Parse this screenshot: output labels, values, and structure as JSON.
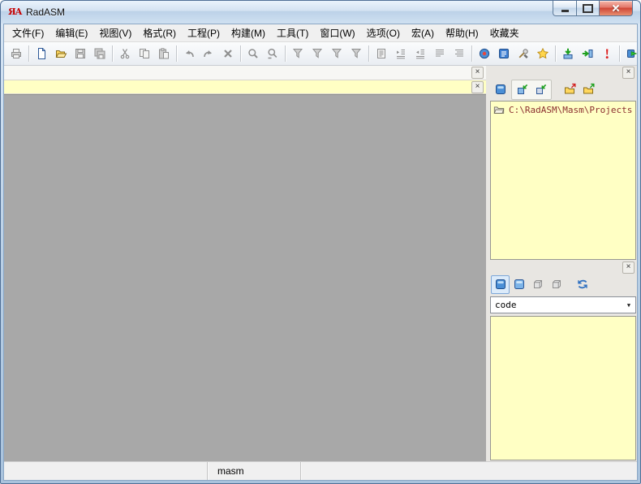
{
  "window": {
    "title": "RadASM",
    "logo_glyph": "ЯA"
  },
  "icons": {
    "close_glyph": "×",
    "combo_arrow_glyph": "▼"
  },
  "colors": {
    "panel_yellow": "#ffffc4",
    "mdi_gray": "#a8a8a8",
    "titlebar_blue": "#cfe0f1",
    "close_button_red": "#cf4636",
    "tree_text": "#8b2f2f"
  },
  "menu": {
    "items": [
      {
        "id": "file",
        "label": "文件(F)"
      },
      {
        "id": "edit",
        "label": "编辑(E)"
      },
      {
        "id": "view",
        "label": "视图(V)"
      },
      {
        "id": "format",
        "label": "格式(R)"
      },
      {
        "id": "project",
        "label": "工程(P)"
      },
      {
        "id": "make",
        "label": "构建(M)"
      },
      {
        "id": "tools",
        "label": "工具(T)"
      },
      {
        "id": "window",
        "label": "窗口(W)"
      },
      {
        "id": "options",
        "label": "选项(O)"
      },
      {
        "id": "macro",
        "label": "宏(A)"
      },
      {
        "id": "help",
        "label": "帮助(H)"
      },
      {
        "id": "favorites",
        "label": "收藏夹"
      }
    ]
  },
  "toolbar": {
    "buttons": [
      {
        "icon": "print",
        "enabled": false
      },
      {
        "sep": true
      },
      {
        "icon": "new-file",
        "enabled": true
      },
      {
        "icon": "open-file",
        "enabled": true
      },
      {
        "icon": "save",
        "enabled": false
      },
      {
        "icon": "save-all",
        "enabled": false
      },
      {
        "sep": true
      },
      {
        "icon": "cut",
        "enabled": false
      },
      {
        "icon": "copy",
        "enabled": false
      },
      {
        "icon": "paste",
        "enabled": false
      },
      {
        "sep": true
      },
      {
        "icon": "undo",
        "enabled": false
      },
      {
        "icon": "redo",
        "enabled": false
      },
      {
        "icon": "delete",
        "enabled": false
      },
      {
        "sep": true
      },
      {
        "icon": "find",
        "enabled": false
      },
      {
        "icon": "find-next",
        "enabled": false
      },
      {
        "sep": true
      },
      {
        "icon": "toggle-bookmark",
        "enabled": false
      },
      {
        "icon": "next-bookmark",
        "enabled": false
      },
      {
        "icon": "prev-bookmark",
        "enabled": false
      },
      {
        "icon": "clear-bookmarks",
        "enabled": false
      },
      {
        "sep": true
      },
      {
        "icon": "copy-section",
        "enabled": false
      },
      {
        "icon": "indent",
        "enabled": false
      },
      {
        "icon": "outdent",
        "enabled": false
      },
      {
        "icon": "align-lines",
        "enabled": false
      },
      {
        "icon": "align-fields",
        "enabled": false
      },
      {
        "sep": true
      },
      {
        "icon": "project-browser",
        "enabled": true
      },
      {
        "icon": "templates",
        "enabled": true
      },
      {
        "icon": "project-options",
        "enabled": true
      },
      {
        "icon": "addins",
        "enabled": true
      },
      {
        "sep": true
      },
      {
        "icon": "assemble",
        "enabled": true
      },
      {
        "icon": "link",
        "enabled": true
      },
      {
        "icon": "build-errors",
        "enabled": true
      },
      {
        "sep": true
      },
      {
        "icon": "run",
        "enabled": true
      }
    ]
  },
  "project_panel": {
    "root_path": "C:\\RadASM\\Masm\\Projects",
    "toolbar": [
      {
        "icon": "project-view",
        "enabled": true
      },
      {
        "icon": "add-module",
        "enabled": true,
        "box": true
      },
      {
        "icon": "add-project",
        "enabled": true,
        "box": true
      },
      {
        "icon": "open-folder-red",
        "enabled": true,
        "gap": true
      },
      {
        "icon": "open-folder-green",
        "enabled": true
      }
    ]
  },
  "properties_panel": {
    "combo_value": "code",
    "toolbar": [
      {
        "icon": "dialog-editor",
        "enabled": true,
        "selected": true
      },
      {
        "icon": "code-editor",
        "enabled": true
      },
      {
        "icon": "resource-cube-1",
        "enabled": false
      },
      {
        "icon": "resource-cube-2",
        "enabled": false
      },
      {
        "icon": "refresh",
        "enabled": true,
        "gap": true
      }
    ]
  },
  "statusbar": {
    "sections": [
      "",
      "masm",
      ""
    ]
  }
}
